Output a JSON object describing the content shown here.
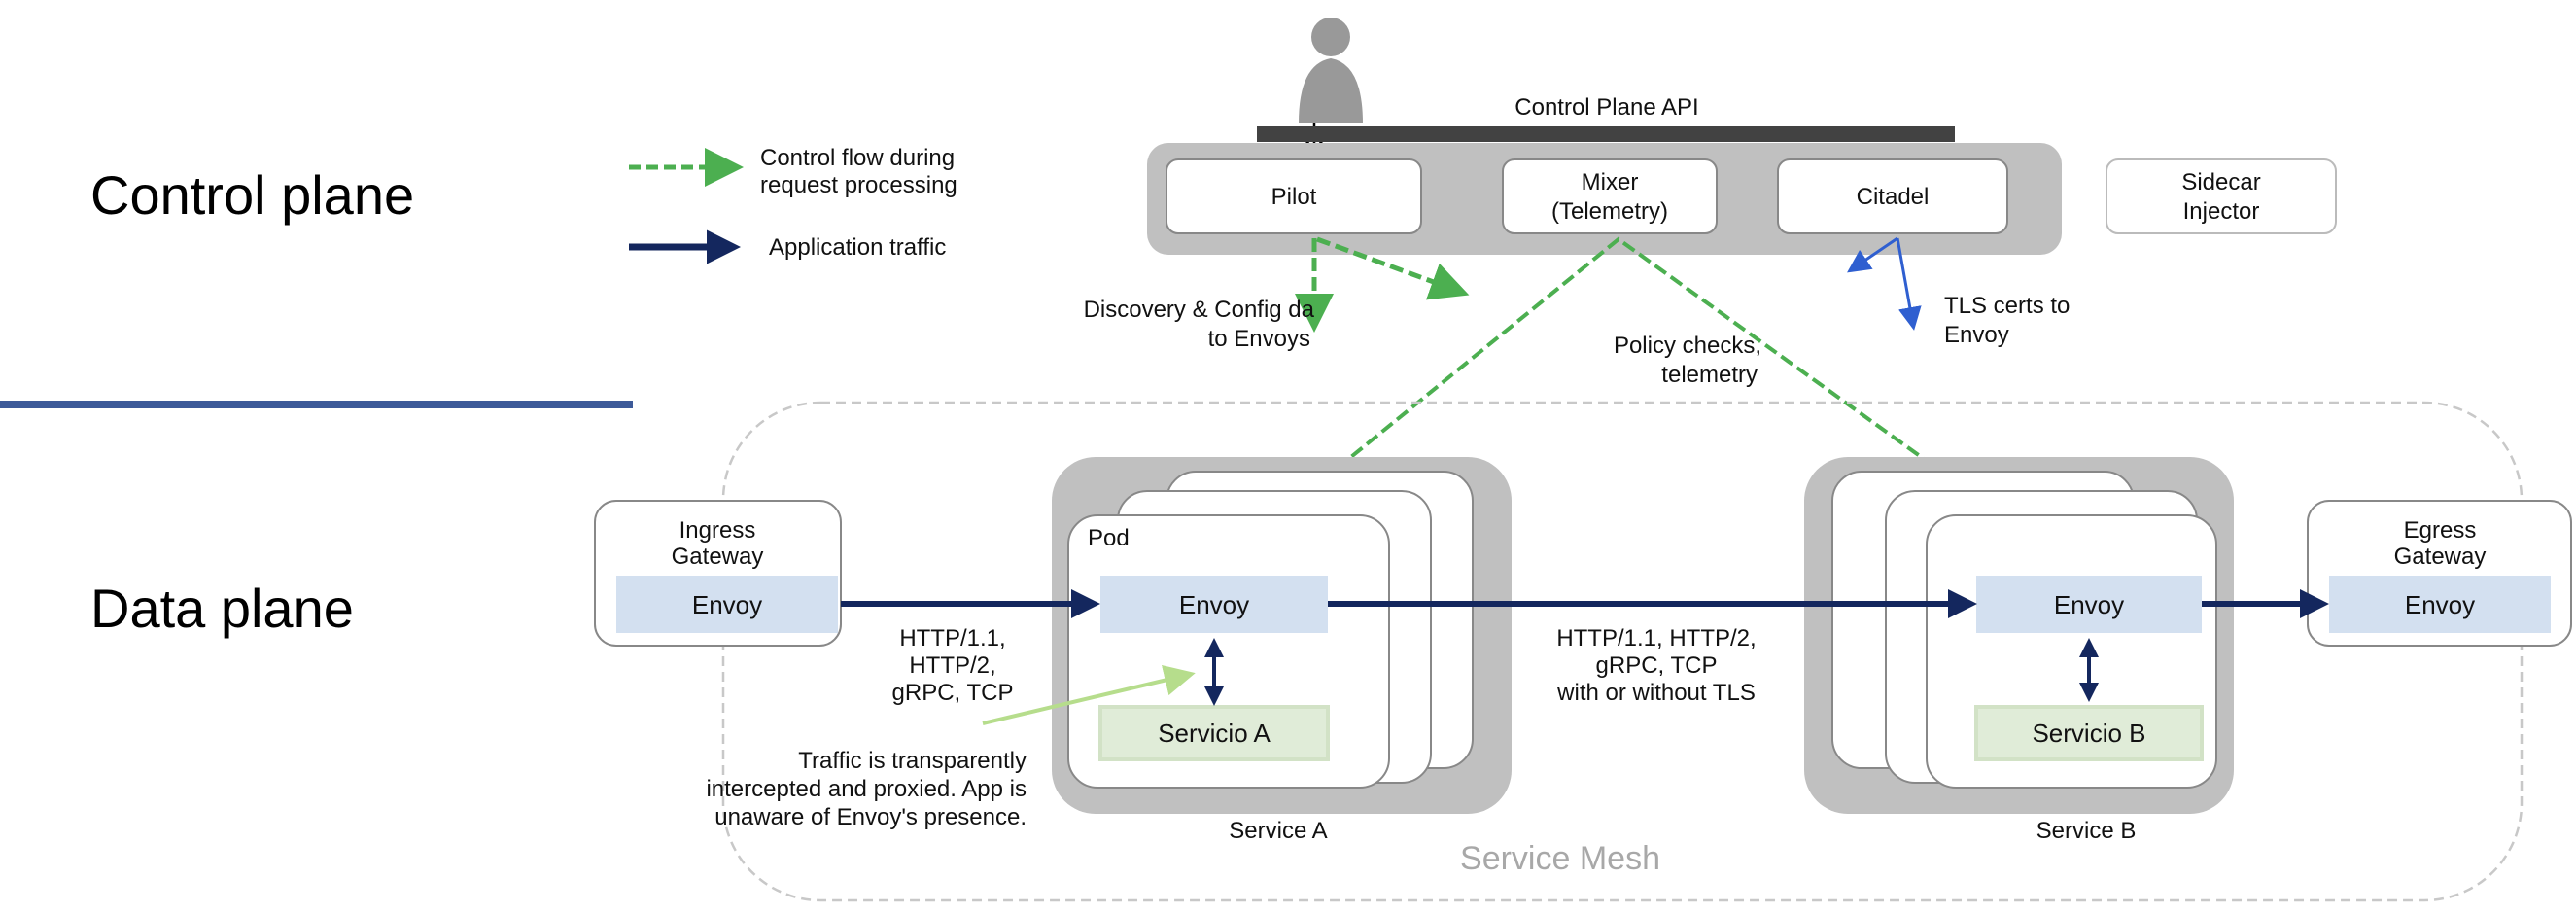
{
  "sections": {
    "control_plane": "Control plane",
    "data_plane": "Data plane"
  },
  "legend": {
    "control_flow_line1": "Control flow during",
    "control_flow_line2": "request processing",
    "app_traffic": "Application traffic"
  },
  "control_plane": {
    "api_label": "Control Plane API",
    "pilot": "Pilot",
    "mixer_line1": "Mixer",
    "mixer_line2": "(Telemetry)",
    "citadel": "Citadel",
    "sidecar_line1": "Sidecar",
    "sidecar_line2": "Injector"
  },
  "annotations": {
    "discovery_line1": "Discovery & Config da",
    "discovery_line2": "to Envoys",
    "policy_line1": "Policy checks,",
    "policy_line2": "telemetry",
    "tls_line1": "TLS certs to",
    "tls_line2": "Envoy",
    "proto_left": [
      "HTTP/1.1,",
      "HTTP/2,",
      "gRPC, TCP"
    ],
    "proto_mid": [
      "HTTP/1.1, HTTP/2,",
      "gRPC, TCP",
      "with or without TLS"
    ],
    "traffic_note": [
      "Traffic is transparently",
      "intercepted and proxied. App is",
      "unaware of Envoy's presence."
    ]
  },
  "data_plane": {
    "ingress_line1": "Ingress",
    "ingress_line2": "Gateway",
    "egress_line1": "Egress",
    "egress_line2": "Gateway",
    "envoy": "Envoy",
    "pod": "Pod",
    "servicio_a": "Servicio A",
    "servicio_b": "Servicio B",
    "service_a": "Service A",
    "service_b": "Service B",
    "service_mesh": "Service Mesh"
  },
  "colors": {
    "control_flow": "#4caf50",
    "app_traffic": "#14275e",
    "tls": "#2f5fd0",
    "divider": "#3d5a99",
    "envoy_fill": "#d3e0f0",
    "servicio_fill": "#e0ecd8",
    "container_grey": "#c0c0c0"
  }
}
